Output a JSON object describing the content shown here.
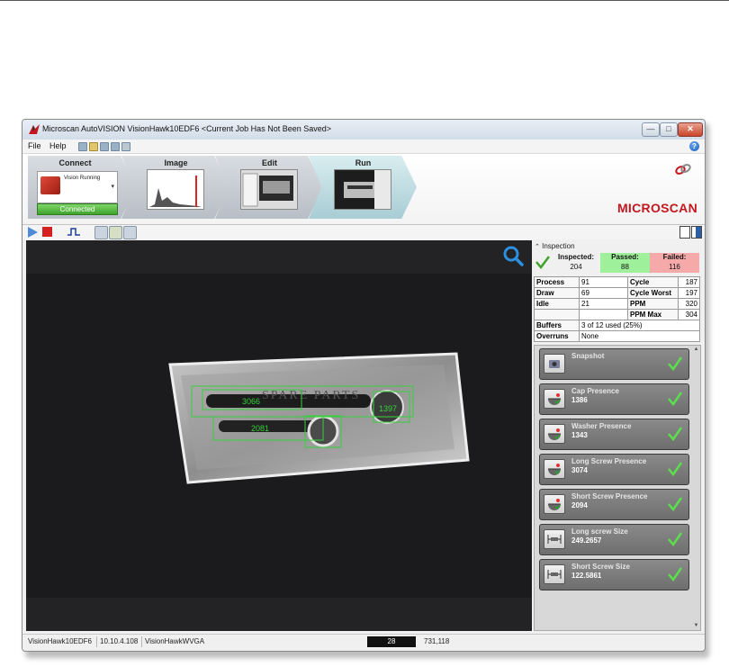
{
  "window": {
    "title": "Microscan AutoVISION    VisionHawk10EDF6 <Current Job Has Not Been Saved>",
    "minimize": "—",
    "maximize": "□",
    "close": "✕"
  },
  "menu": {
    "file": "File",
    "help": "Help",
    "help_icon": "?"
  },
  "steps": {
    "connect": {
      "label": "Connect",
      "camera_text": "Vision Running",
      "status": "Connected"
    },
    "image": {
      "label": "Image"
    },
    "edit": {
      "label": "Edit"
    },
    "run": {
      "label": "Run"
    }
  },
  "brand": "MICROSCAN",
  "inspection": {
    "header": "Inspection",
    "inspected_label": "Inspected:",
    "inspected_value": "204",
    "passed_label": "Passed:",
    "passed_value": "88",
    "failed_label": "Failed:",
    "failed_value": "116"
  },
  "stats": {
    "process_label": "Process",
    "process_value": "91",
    "cycle_label": "Cycle",
    "cycle_value": "187",
    "draw_label": "Draw",
    "draw_value": "69",
    "cycle_worst_label": "Cycle Worst",
    "cycle_worst_value": "197",
    "idle_label": "Idle",
    "idle_value": "21",
    "ppm_label": "PPM",
    "ppm_value": "320",
    "ppm_max_label": "PPM Max",
    "ppm_max_value": "304",
    "buffers_label": "Buffers",
    "buffers_value": "3 of 12 used (25%)",
    "overruns_label": "Overruns",
    "overruns_value": "None"
  },
  "tools": [
    {
      "name": "Snapshot",
      "value": "",
      "icon": "camera-icon"
    },
    {
      "name": "Cap Presence",
      "value": "1386",
      "icon": "presence-icon"
    },
    {
      "name": "Washer Presence",
      "value": "1343",
      "icon": "presence-icon"
    },
    {
      "name": "Long Screw Presence",
      "value": "3074",
      "icon": "presence-icon"
    },
    {
      "name": "Short Screw Presence",
      "value": "2094",
      "icon": "presence-icon"
    },
    {
      "name": "Long screw Size",
      "value": "249.2657",
      "icon": "measure-icon"
    },
    {
      "name": "Short Screw Size",
      "value": "122.5861",
      "icon": "measure-icon"
    }
  ],
  "overlay": {
    "label_1": "3066",
    "label_2": "1397",
    "label_3": "2081",
    "package_text": "SPARE PARTS"
  },
  "status": {
    "device": "VisionHawk10EDF6",
    "ip": "10.10.4.108",
    "model": "VisionHawkWVGA",
    "frame": "28",
    "coords": "731,118"
  },
  "colors": {
    "brand": "#c4161c",
    "connected": "#3fa32c",
    "passed_bg": "#9ff09a",
    "failed_bg": "#f5a9a9",
    "overlay": "#35d13a",
    "zoom": "#2d8fe0"
  }
}
